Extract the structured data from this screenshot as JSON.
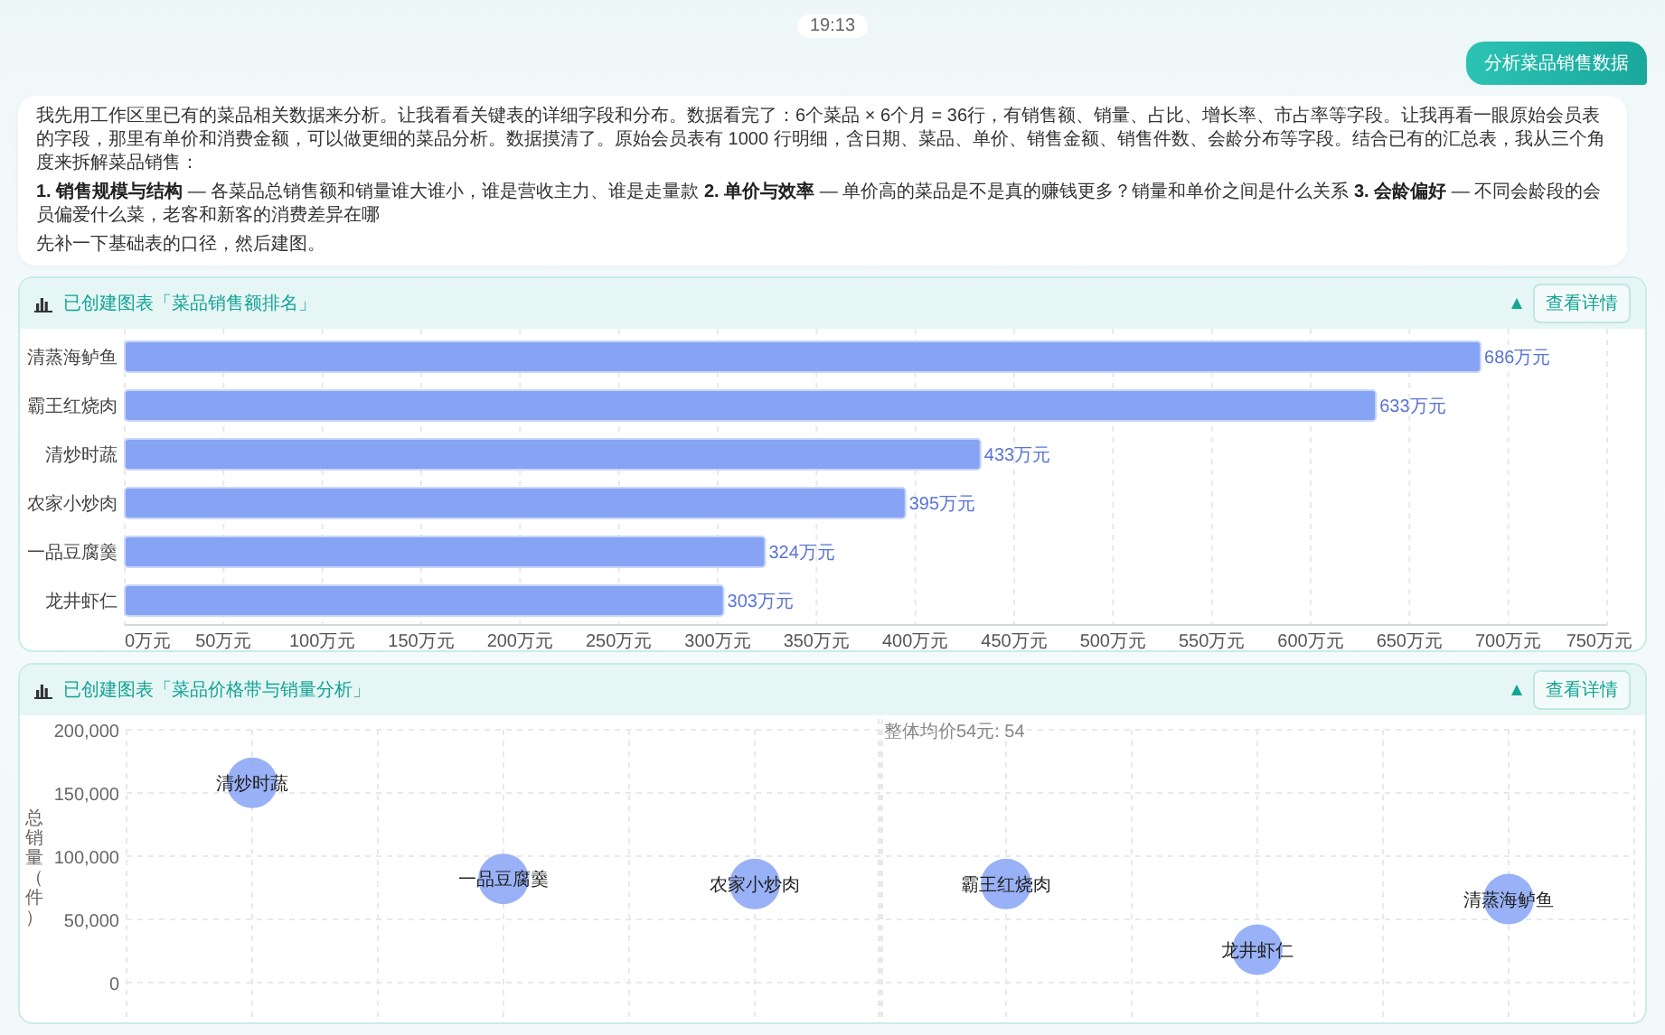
{
  "time": "19:13",
  "user_message": "分析菜品销售数据",
  "assistant_message": {
    "paragraphs": [
      "我先用工作区里已有的菜品相关数据来分析。让我看看关键表的详细字段和分布。数据看完了：6个菜品 × 6个月 = 36行，有销售额、销量、占比、增长率、市占率等字段。让我再看一眼原始会员表的字段，那里有单价和消费金额，可以做更细的菜品分析。数据摸清了。原始会员表有 1000 行明细，含日期、菜品、单价、销售金额、销售件数、会龄分布等字段。结合已有的汇总表，我从三个角度来拆解菜品销售：",
      "**1. 销售规模与结构** — 各菜品总销售额和销量谁大谁小，谁是营收主力、谁是走量款 **2. 单价与效率** — 单价高的菜品是不是真的赚钱更多？销量和单价之间是什么关系 **3. 会龄偏好** — 不同会龄段的会员偏爱什么菜，老客和新客的消费差异在哪",
      "先补一下基础表的口径，然后建图。"
    ]
  },
  "charts": [
    {
      "title": "已创建图表「菜品销售额排名」",
      "expanded": true,
      "button": "查看详情",
      "chart_data": {
        "type": "bar",
        "orientation": "horizontal",
        "grid": true,
        "categories": [
          "清蒸海鲈鱼",
          "霸王红烧肉",
          "清炒时蔬",
          "农家小炒肉",
          "一品豆腐羹",
          "龙井虾仁"
        ],
        "values": [
          686,
          633,
          433,
          395,
          324,
          303
        ],
        "value_labels": [
          "686万元",
          "633万元",
          "433万元",
          "395万元",
          "324万元",
          "303万元"
        ],
        "xlim": [
          0,
          750
        ],
        "xticks": [
          {
            "value": 0,
            "label": "0万元"
          },
          {
            "value": 50,
            "label": "50万元"
          },
          {
            "value": 100,
            "label": "100万元"
          },
          {
            "value": 150,
            "label": "150万元"
          },
          {
            "value": 200,
            "label": "200万元"
          },
          {
            "value": 250,
            "label": "250万元"
          },
          {
            "value": 300,
            "label": "300万元"
          },
          {
            "value": 350,
            "label": "350万元"
          },
          {
            "value": 400,
            "label": "400万元"
          },
          {
            "value": 450,
            "label": "450万元"
          },
          {
            "value": 500,
            "label": "500万元"
          },
          {
            "value": 550,
            "label": "550万元"
          },
          {
            "value": 600,
            "label": "600万元"
          },
          {
            "value": 650,
            "label": "650万元"
          },
          {
            "value": 700,
            "label": "700万元"
          },
          {
            "value": 750,
            "label": "750万元"
          }
        ]
      }
    },
    {
      "title": "已创建图表「菜品价格带与销量分析」",
      "expanded": true,
      "button": "查看详情",
      "chart_data": {
        "type": "scatter",
        "ylabel": "总销量（件）",
        "grid": true,
        "ylim": [
          0,
          200000
        ],
        "categories": [
          "清炒时蔬",
          "一品豆腐羹",
          "农家小炒肉",
          "霸王红烧肉",
          "龙井虾仁",
          "清蒸海鲈鱼"
        ],
        "yticks": [
          {
            "value": 0,
            "label": "0"
          },
          {
            "value": 50000,
            "label": "50,000"
          },
          {
            "value": 100000,
            "label": "100,000"
          },
          {
            "value": 150000,
            "label": "150,000"
          },
          {
            "value": 200000,
            "label": "200,000"
          }
        ],
        "series": [
          {
            "color": "#8ea8f5",
            "values": [
              158000,
              82000,
              78000,
              78000,
              26000,
              66000
            ]
          }
        ],
        "annotations": [
          {
            "text": "整体均价54元: 54"
          }
        ]
      }
    }
  ]
}
